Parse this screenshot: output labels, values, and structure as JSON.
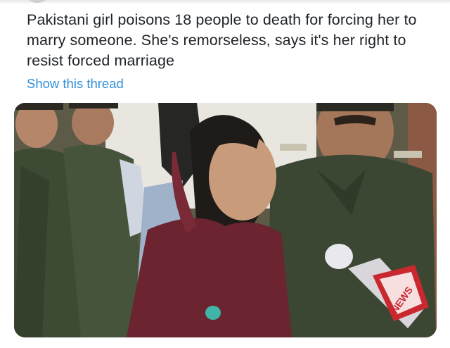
{
  "tweet": {
    "text": "Pakistani girl poisons 18 people to death for forcing her to marry someone. She's remorseless, says it's her right to resist forced marriage",
    "show_thread_label": "Show this thread"
  },
  "media": {
    "microphone_logo_text": "NEWS"
  },
  "colors": {
    "link": "#2f8fd8",
    "text": "#1f2328",
    "uniform": "#3b4a33",
    "shawl": "#6b2430"
  }
}
